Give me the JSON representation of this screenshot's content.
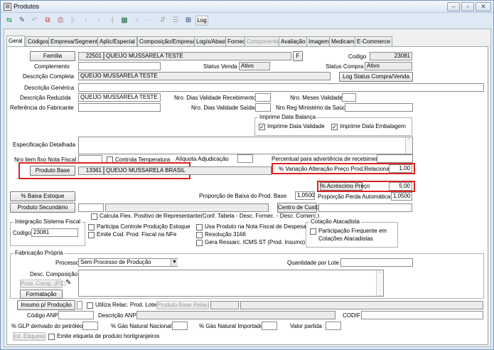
{
  "window": {
    "title": "Produtos"
  },
  "toolbar": {
    "log_label": "Log"
  },
  "tabs": [
    "Geral",
    "Códigos",
    "Empresa/Segmento",
    "Aplic/Especial",
    "Composição/Empresa",
    "Logís/Abast",
    "Fornec",
    "Componentes",
    "Avaliação",
    "Imagem",
    "Medicam.",
    "E-Commerce"
  ],
  "form": {
    "familia_button": "Família",
    "familia_code": "22501",
    "familia_name": "QUEIJO MUSSARELA TESTE",
    "f_button": "F",
    "codigo_label": "Codigo",
    "codigo_value": "23081",
    "complemento_label": "Complemento",
    "status_venda_label": "Status Venda",
    "status_venda_value": "Ativo",
    "status_compra_label": "Status Compra",
    "status_compra_value": "Ativo",
    "descricao_completa_label": "Descrição Completa",
    "descricao_completa_value": "QUEIJO MUSSARELA TESTE",
    "log_status_button": "Log Status Compra/Venda",
    "descricao_generica_label": "Descrição Genérica",
    "descricao_reduzida_label": "Descrição Reduzida",
    "descricao_reduzida_value": "QUEIJO MUSSARELA TESTE",
    "nro_dias_receb_label": "Nro. Dias Validade Recebimento",
    "nro_meses_label": "Nro. Meses Validade",
    "referencia_label": "Referência do Fabricante",
    "nro_dias_saidas_label": "Nro. Dias Validade Saídas",
    "nro_reg_ms_label": "Nro Reg Ministério da Saúde",
    "imprime_group": "Imprime Data Balança",
    "imprime_validade": "Imprime Data Validade",
    "imprime_embalagem": "Imprime Data Embalagem",
    "especificacao_label": "Especificação Detalhada",
    "nro_item_nf_label": "Nro item fixo Nota Fiscal",
    "controla_temp_label": "Controla Temperatura",
    "aliquota_label": "Alíquota Adjudicação",
    "percentual_label": "Percentual para advertência de recebimento",
    "produto_base_button": "Produto Base",
    "produto_base_code": "13361",
    "produto_base_name": "QUEIJO MUSSARELA BRASIL",
    "variacao_label": "% Variação Alteração Preço Prod.Relacionado",
    "variacao_value": "1,00",
    "acrescimo_button": "% Acréscimo Preço",
    "acrescimo_value": "5,00",
    "baixa_estoque_button": "% Baixa Estoque",
    "proporcao_baixa_label": "Proporção de Baixa do Prod. Base",
    "proporcao_baixa_value": "1,0500",
    "proporcao_perda_label": "Proporção Perda Automática",
    "proporcao_perda_value": "1,0500",
    "produto_secundario_button": "Produto Secundário",
    "centro_custo_button": "Centro de Custo",
    "calcula_flex_label": "Calcula Flex. Positivo de Representante(Conf. Tabela - Desc. Fornec. - Desc. Comerc.)",
    "integracao_group": "Integração Sistema Fiscal",
    "integracao_codigo_label": "Codigo",
    "integracao_codigo_value": "23081",
    "participa_promo_label": "Participa Controle Produção Estoque",
    "emite_cod_label": "Emite Cod. Prod. Fiscal na NFe",
    "usa_produto_label": "Usa Produto na Nota Fiscal de Despesa",
    "resolucao_label": "Resolução 3166",
    "gera_ressarc_label": "Gera Ressarc. ICMS ST (Prod. Insumo)",
    "cotacao_group": "Cotação Atacadista",
    "cotacao_label1": "Participação Frequente em",
    "cotacao_label2": "Cotações Atacadistas",
    "fabricacao_group": "Fabricação Própria",
    "processo_label": "Processo",
    "processo_value": "Sem Processo de Produção",
    "quantidade_lote_label": "Quantidade por Lote",
    "desc_composicao_label": "Desc. Composição",
    "prod_comp_button": "Prod. Comp. (PC)",
    "formatacao_button": "Formatação",
    "insumo_button": "Insumo p/ Produção",
    "utiliza_relac_label": "Utiliza Relac. Prod. Lote",
    "produto_base_relac_button": "Produto Base Relac.",
    "codigo_anp_label": "Código ANP",
    "descricao_anp_label": "Descrição ANP",
    "codif_label": "CODIF",
    "glp_label": "% GLP derivado do petróleo",
    "gas_nacional_label": "% Gás Natural Nacional",
    "gas_importado_label": "% Gás Natural Importado",
    "valor_partida_label": "Valor partida",
    "inf_etiqueta_button": "Inf. Etiqueta",
    "emite_etiqueta_label": "Emite etiqueta de produto hortigranjeiros"
  },
  "colors": {
    "highlight": "#e02020",
    "title_bg": "#dbe6f3"
  }
}
